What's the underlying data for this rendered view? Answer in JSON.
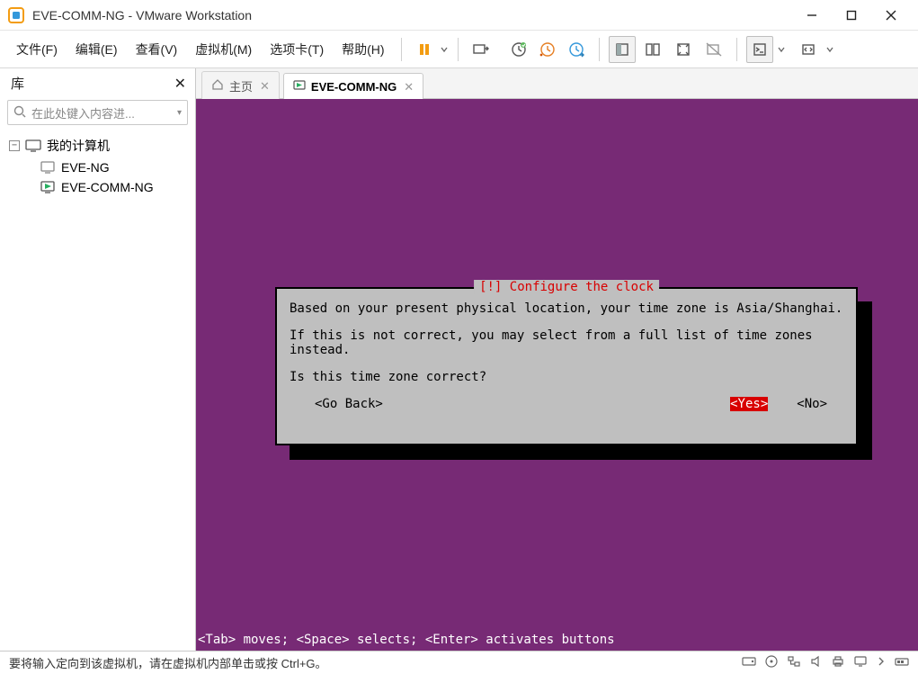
{
  "titlebar": {
    "title": "EVE-COMM-NG - VMware Workstation"
  },
  "menu": {
    "file": "文件(F)",
    "edit": "编辑(E)",
    "view": "查看(V)",
    "vm": "虚拟机(M)",
    "tabs": "选项卡(T)",
    "help": "帮助(H)"
  },
  "sidebar": {
    "header": "库",
    "search_placeholder": "在此处键入内容进...",
    "root": "我的计算机",
    "items": [
      "EVE-NG",
      "EVE-COMM-NG"
    ]
  },
  "tabs": {
    "home": "主页",
    "active": "EVE-COMM-NG"
  },
  "dialog": {
    "title": "[!] Configure the clock",
    "line1": "Based on your present physical location, your time zone is Asia/Shanghai.",
    "line2": "If this is not correct, you may select from a full list of time zones instead.",
    "line3": "Is this time zone correct?",
    "go_back": "<Go Back>",
    "yes": "<Yes>",
    "no": "<No>"
  },
  "vm_hint": "<Tab> moves; <Space> selects; <Enter> activates buttons",
  "statusbar": {
    "text": "要将输入定向到该虚拟机，请在虚拟机内部单击或按 Ctrl+G。"
  }
}
